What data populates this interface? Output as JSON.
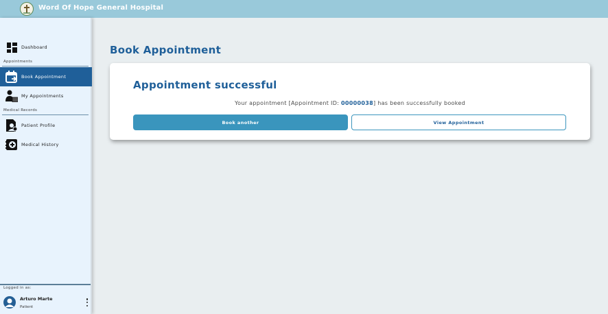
{
  "app": {
    "title": "Word Of Hope General Hospital"
  },
  "sidebar": {
    "items": [
      {
        "label": "Dashboard",
        "icon": "dashboard-icon"
      },
      {
        "label": "Book Appointment",
        "icon": "calendar-icon",
        "active": true
      },
      {
        "label": "My Appointments",
        "icon": "doctor-icon"
      },
      {
        "label": "Patient Profile",
        "icon": "profile-document-icon"
      },
      {
        "label": "Medical History",
        "icon": "medical-history-icon"
      }
    ],
    "sections": {
      "appointments": "Appointments",
      "medical_records": "Medical Records"
    },
    "logged_in_label": "Logged in as:",
    "user": {
      "name": "Arturo Marte",
      "role": "Patient"
    }
  },
  "main": {
    "page_title": "Book Appointment",
    "card": {
      "title": "Appointment successful",
      "message_before": "Your appointment [Appointment ID: ",
      "appointment_id": "00000038",
      "message_after": "] has been successfully booked",
      "book_another_label": "Book another",
      "view_appointment_label": "View Appointment"
    }
  },
  "colors": {
    "header": "#99c9da",
    "accent": "#1f5f99",
    "button": "#3a95bd",
    "sidebar_bg": "#e8f3fd",
    "page_bg": "#e9eef0"
  }
}
